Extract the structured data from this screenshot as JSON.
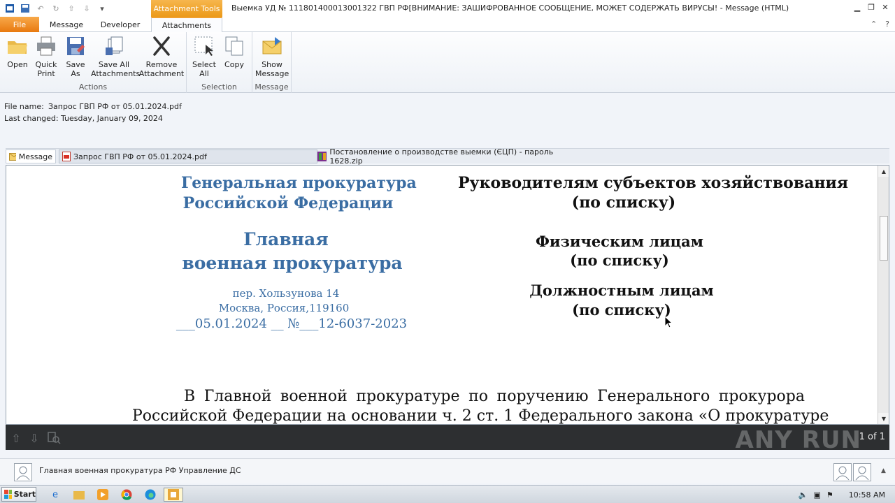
{
  "window": {
    "context_tab": "Attachment Tools",
    "title": "Выемка УД № 11180140001300132​2  ГВП РФ[ВНИМАНИЕ: ЗАШИФРОВАННОЕ СООБЩЕНИЕ, МОЖЕТ СОДЕРЖАТЬ ВИРУСЫ! -  Message (HTML)"
  },
  "tabs": [
    "File",
    "Message",
    "Developer",
    "Attachments"
  ],
  "ribbon": {
    "groups": [
      {
        "label": "Actions",
        "buttons": [
          "Open",
          "Quick Print",
          "Save As",
          "Save All Attachments",
          "Remove Attachment"
        ]
      },
      {
        "label": "Selection",
        "buttons": [
          "Select All",
          "Copy"
        ]
      },
      {
        "label": "Message",
        "buttons": [
          "Show Message"
        ]
      }
    ]
  },
  "fileinfo": {
    "name_label": "File name:",
    "name_value": "Запрос ГВП РФ от 05.01.2024.pdf",
    "changed_label": "Last changed:",
    "changed_value": "Tuesday, January 09, 2024"
  },
  "attachments": {
    "message": "Message",
    "pdf": "Запрос ГВП РФ от 05.01.2024.pdf",
    "zip": "Постановление о производстве выемки (ЄЦП) - пароль 1628.zip"
  },
  "doc": {
    "org1": "Генеральная прокуратура",
    "org2": "Российской Федерации",
    "dept1": "Главная",
    "dept2": "военная прокуратура",
    "addr1": "пер. Хользунова 14",
    "addr2": "Москва, Россия,119160",
    "ref": "___05.01.2024 __ №___12-6037-2023",
    "to1a": "Руководителям субъектов хозяйствования",
    "to1b": "(по списку)",
    "to2a": "Физическим лицам",
    "to2b": "(по списку)",
    "to3a": "Должностным лицам",
    "to3b": "(по списку)",
    "body1": "В Главной военной прокуратуре по поручению Генерального прокурора",
    "body2": "Российской Федерации на основании ч. 2 ст. 1 Федерального закона «О прокуратуре"
  },
  "navbar": {
    "page": "1 of 1",
    "watermark": "ANY RUN"
  },
  "people": {
    "name": "Главная военная прокуратура РФ Управление ДС"
  },
  "taskbar": {
    "start": "Start",
    "time": "10:58 AM"
  }
}
